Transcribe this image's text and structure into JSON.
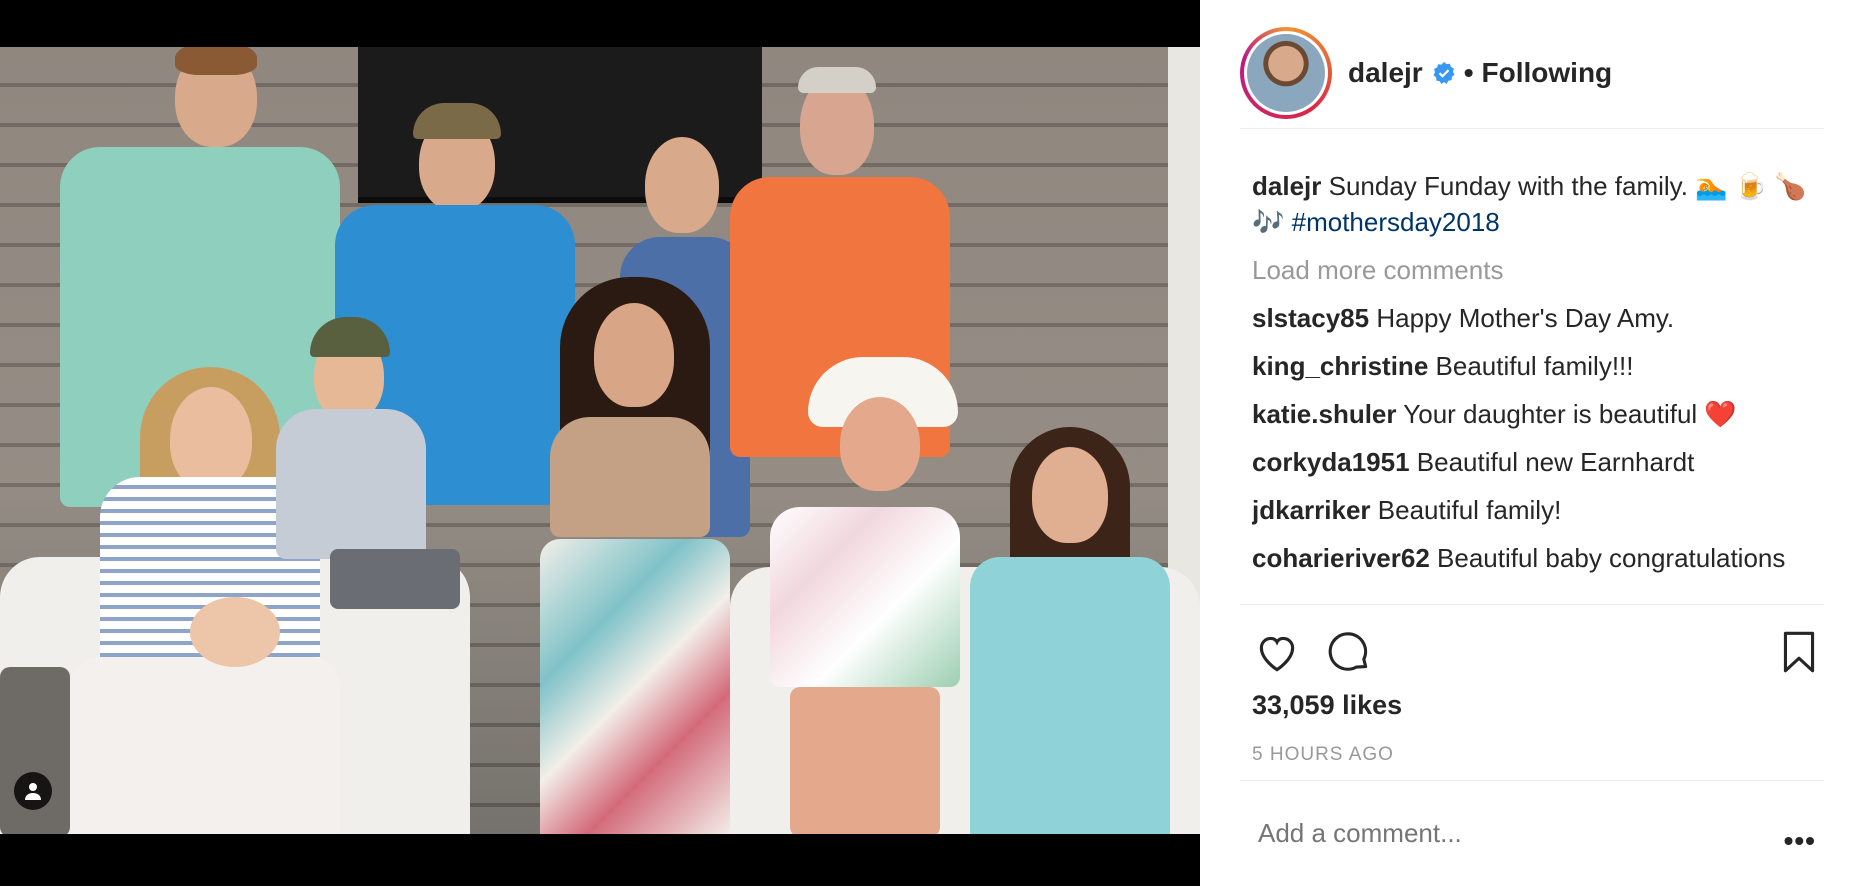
{
  "post": {
    "username": "dalejr",
    "follow_status": "Following",
    "separator": "•"
  },
  "caption": {
    "username": "dalejr",
    "text": "Sunday Funday with the family. 🏊 🍺 🍗 🎶",
    "hashtag": "#mothersday2018"
  },
  "load_more": "Load more comments",
  "comments": [
    {
      "user": "slstacy85",
      "text": "Happy Mother's Day Amy."
    },
    {
      "user": "king_christine",
      "text": "Beautiful family!!!"
    },
    {
      "user": "katie.shuler",
      "text": "Your daughter is beautiful ❤️"
    },
    {
      "user": "corkyda1951",
      "text": "Beautiful new Earnhardt"
    },
    {
      "user": "jdkarriker",
      "text": "Beautiful family!"
    },
    {
      "user": "coharieriver62",
      "text": "Beautiful baby congratulations"
    }
  ],
  "likes": "33,059 likes",
  "timestamp": "5 HOURS AGO",
  "comment_input": {
    "placeholder": "Add a comment..."
  },
  "more_label": "•••",
  "colors": {
    "link": "#003569",
    "muted": "#999999",
    "text": "#262626",
    "heart": "#ed4956"
  }
}
